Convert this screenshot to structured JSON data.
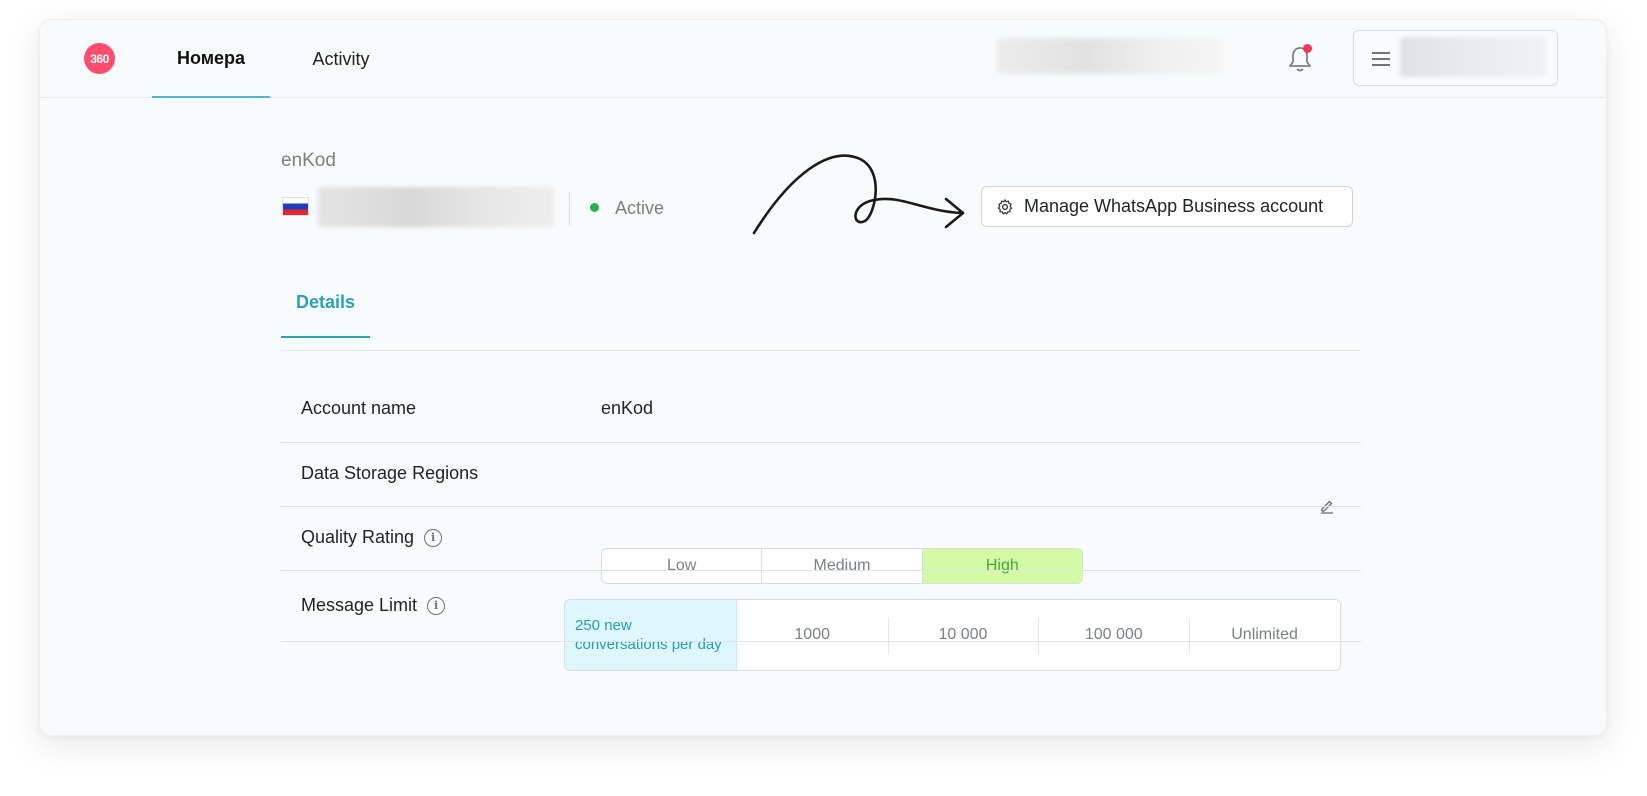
{
  "app": {
    "logo_text": "360",
    "nav_tabs": [
      {
        "label": "Номера",
        "active": true
      },
      {
        "label": "Activity",
        "active": false
      }
    ],
    "notifications_unread": true
  },
  "account": {
    "title": "enKod",
    "status": "Active",
    "manage_button_label": "Manage WhatsApp Business account"
  },
  "tabs": {
    "details": "Details"
  },
  "details": {
    "account_name_label": "Account name",
    "account_name_value": "enKod",
    "data_storage_label": "Data Storage Regions",
    "quality_rating_label": "Quality Rating",
    "quality_options": [
      "Low",
      "Medium",
      "High"
    ],
    "quality_selected": "High",
    "message_limit_label": "Message Limit",
    "message_limit_options": [
      "250 new conversations per day",
      "1000",
      "10 000",
      "100 000",
      "Unlimited"
    ],
    "message_limit_selected": "250 new conversations per day"
  },
  "colors": {
    "accent": "#2aa3b8",
    "logo": "#ff4d6d",
    "status_active": "#27b14e",
    "quality_high_bg": "#d3fba5",
    "limit_selected_bg": "#def7fd"
  },
  "icons": [
    "logo-icon",
    "flag-russia-icon",
    "bell-icon",
    "hamburger-icon",
    "gear-icon",
    "edit-icon",
    "info-icon",
    "arrow-annotation"
  ]
}
